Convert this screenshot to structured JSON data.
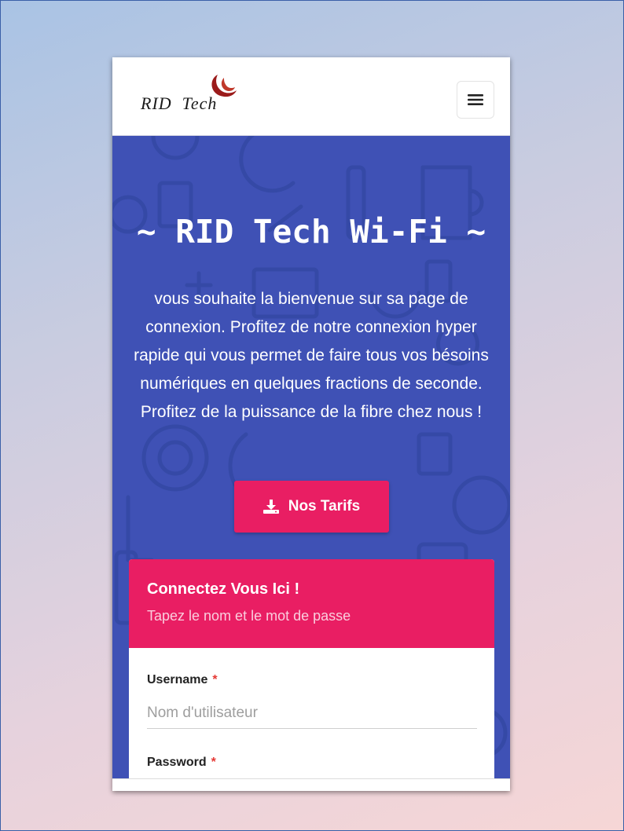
{
  "header": {
    "logo_text": "RID  Tech",
    "logo_color": "#9b1b1b",
    "menu_icon": "hamburger-menu-icon"
  },
  "hero": {
    "title": "~ RID Tech Wi-Fi ~",
    "description": "vous souhaite la bienvenue sur sa page de connexion. Profitez de notre connexion hyper rapide qui vous permet de faire tous vos bésoins numériques en quelques fractions de seconde. Profitez de la puissance de la fibre chez nous !",
    "cta_label": "Nos Tarifs",
    "cta_icon": "download-icon",
    "background_color": "#3f51b5",
    "accent_color": "#e91e63"
  },
  "login": {
    "title": "Connectez Vous Ici !",
    "subtitle": "Tapez le nom et le mot de passe",
    "username_label": "Username",
    "username_placeholder": "Nom d'utilisateur",
    "password_label": "Password",
    "required_marker": "*"
  }
}
